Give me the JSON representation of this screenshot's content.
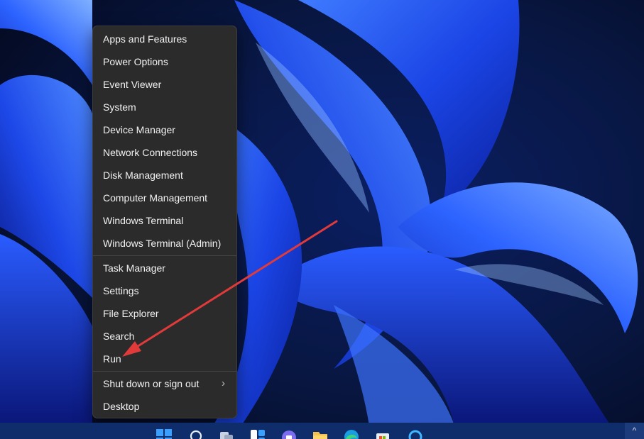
{
  "menu": {
    "group1": [
      {
        "label": "Apps and Features"
      },
      {
        "label": "Power Options"
      },
      {
        "label": "Event Viewer"
      },
      {
        "label": "System"
      },
      {
        "label": "Device Manager"
      },
      {
        "label": "Network Connections"
      },
      {
        "label": "Disk Management"
      },
      {
        "label": "Computer Management"
      },
      {
        "label": "Windows Terminal"
      },
      {
        "label": "Windows Terminal (Admin)"
      }
    ],
    "group2": [
      {
        "label": "Task Manager"
      },
      {
        "label": "Settings"
      },
      {
        "label": "File Explorer"
      },
      {
        "label": "Search"
      },
      {
        "label": "Run"
      }
    ],
    "group3": [
      {
        "label": "Shut down or sign out",
        "submenu_glyph": "›"
      },
      {
        "label": "Desktop"
      }
    ]
  },
  "annotation": {
    "color": "#e03a3a",
    "points_to": "Run"
  },
  "taskbar": {
    "icons": [
      "start-icon",
      "search-icon",
      "task-view-icon",
      "widgets-icon",
      "chat-icon",
      "file-explorer-icon",
      "edge-icon",
      "store-icon",
      "cortana-icon"
    ],
    "tray_chevron": "^"
  },
  "colors": {
    "menu_bg": "#2b2b2b",
    "menu_text": "#f2f2f2",
    "taskbar": "#0f2d6b",
    "wallpaper_blue": "#1f4fe0"
  }
}
